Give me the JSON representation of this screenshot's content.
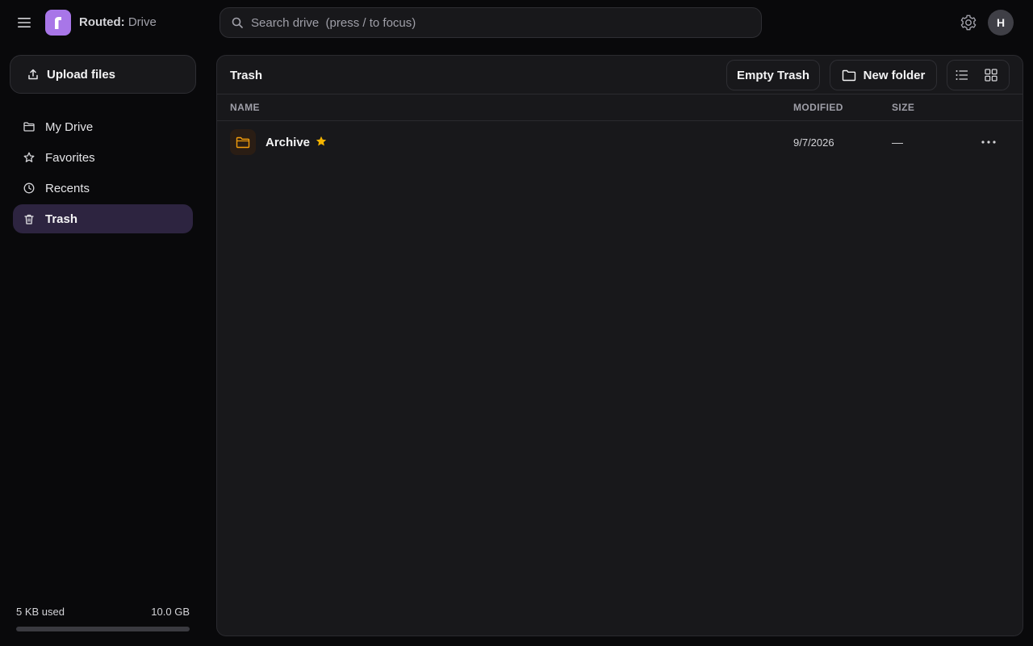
{
  "app": {
    "brand_bold": "Routed:",
    "brand_rest": " Drive",
    "logo_letter": "r",
    "accent_color": "#a876e8"
  },
  "search": {
    "placeholder": "Search drive  (press / to focus)"
  },
  "user": {
    "initial": "H"
  },
  "sidebar": {
    "upload_label": "Upload files",
    "items": [
      {
        "label": "My Drive",
        "icon": "folder-icon",
        "active": false
      },
      {
        "label": "Favorites",
        "icon": "star-icon",
        "active": false
      },
      {
        "label": "Recents",
        "icon": "clock-icon",
        "active": false
      },
      {
        "label": "Trash",
        "icon": "trash-icon",
        "active": true
      }
    ],
    "storage": {
      "used": "5 KB used",
      "total": "10.0 GB",
      "used_fraction": 0.0
    }
  },
  "main": {
    "title": "Trash",
    "empty_trash_label": "Empty Trash",
    "new_folder_label": "New folder",
    "columns": {
      "name": "NAME",
      "modified": "MODIFIED",
      "size": "SIZE"
    },
    "rows": [
      {
        "name": "Archive",
        "starred": true,
        "modified": "9/7/2026",
        "size": "—",
        "type": "folder"
      }
    ]
  }
}
